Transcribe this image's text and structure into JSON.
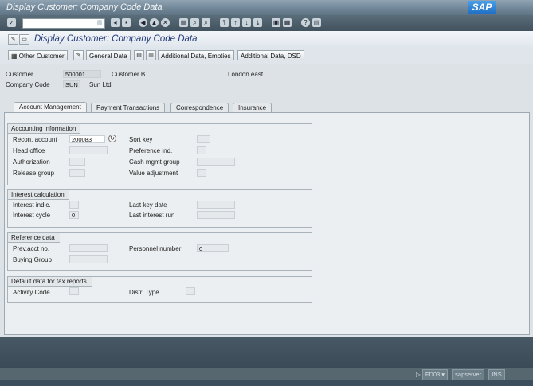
{
  "window": {
    "title": "Display Customer: Company Code Data",
    "brand": "SAP"
  },
  "app_header": {
    "title": "Display Customer: Company Code Data"
  },
  "app_toolbar": {
    "buttons": [
      "Other Customer",
      "General Data",
      "Additional Data, Empties",
      "Additional Data, DSD"
    ]
  },
  "header_fields": {
    "customer_label": "Customer",
    "customer_value": "500001",
    "customer_name": "Customer B",
    "customer_city": "London east",
    "company_code_label": "Company Code",
    "company_code_value": "SUN",
    "company_code_name": "Sun Ltd"
  },
  "tabs": [
    {
      "label": "Account Management",
      "active": true
    },
    {
      "label": "Payment Transactions",
      "active": false
    },
    {
      "label": "Correspondence",
      "active": false
    },
    {
      "label": "Insurance",
      "active": false
    }
  ],
  "groups": {
    "accounting": {
      "title": "Accounting information",
      "recon_account_label": "Recon. account",
      "recon_account_value": "200083",
      "head_office_label": "Head office",
      "authorization_label": "Authorization",
      "release_group_label": "Release group",
      "sort_key_label": "Sort key",
      "preference_ind_label": "Preference ind.",
      "cash_mgmt_group_label": "Cash mgmt group",
      "value_adjustment_label": "Value adjustment"
    },
    "interest": {
      "title": "Interest calculation",
      "interest_indic_label": "Interest indic.",
      "interest_cycle_label": "Interest cycle",
      "interest_cycle_value": "0",
      "last_key_date_label": "Last key date",
      "last_interest_run_label": "Last interest run"
    },
    "reference": {
      "title": "Reference data",
      "prev_acct_label": "Prev.acct no.",
      "buying_group_label": "Buying Group",
      "personnel_number_label": "Personnel number",
      "personnel_number_value": "0"
    },
    "tax": {
      "title": "Default data for tax reports",
      "activity_code_label": "Activity Code",
      "distr_type_label": "Distr. Type"
    }
  },
  "status_bar": {
    "transaction": "FD03",
    "server": "sapserver",
    "mode": "INS"
  }
}
